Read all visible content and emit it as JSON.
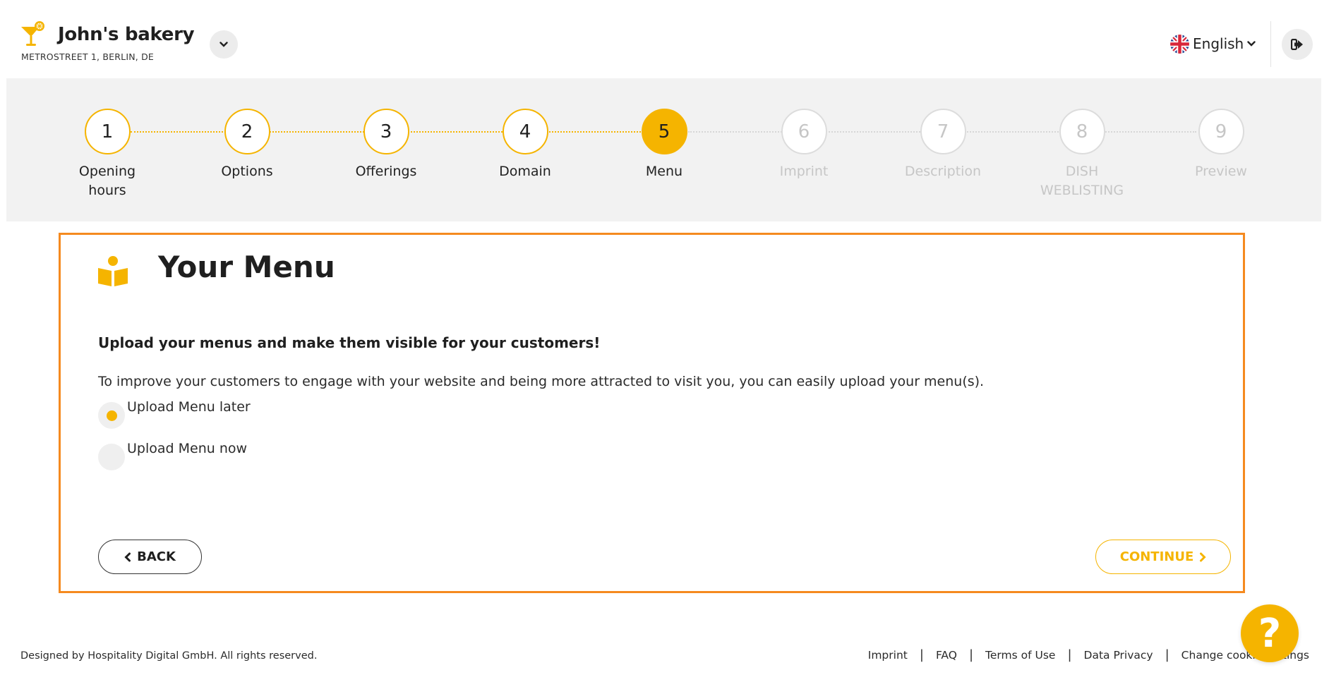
{
  "header": {
    "business_name": "John's bakery",
    "business_address": "METROSTREET 1, BERLIN, DE",
    "logo_icon": "cocktail-logo-icon",
    "dropdown_icon": "chevron-down-icon",
    "language": "English",
    "language_flag": "uk-flag-icon",
    "logout_icon": "logout-icon"
  },
  "stepper": {
    "steps": [
      {
        "number": "1",
        "label": "Opening hours",
        "state": "done"
      },
      {
        "number": "2",
        "label": "Options",
        "state": "done"
      },
      {
        "number": "3",
        "label": "Offerings",
        "state": "done"
      },
      {
        "number": "4",
        "label": "Domain",
        "state": "done"
      },
      {
        "number": "5",
        "label": "Menu",
        "state": "active"
      },
      {
        "number": "6",
        "label": "Imprint",
        "state": "future"
      },
      {
        "number": "7",
        "label": "Description",
        "state": "future"
      },
      {
        "number": "8",
        "label": "DISH WEBLISTING",
        "state": "future"
      },
      {
        "number": "9",
        "label": "Preview",
        "state": "future"
      }
    ]
  },
  "main": {
    "icon": "open-book-reader-icon",
    "title": "Your Menu",
    "subtitle": "Upload your menus and make them visible for your customers!",
    "description": "To improve your customers to engage with your website and being more attracted to visit you, you can easily upload your menu(s).",
    "options": [
      {
        "label": "Upload Menu later",
        "selected": true
      },
      {
        "label": "Upload Menu now",
        "selected": false
      }
    ],
    "back_label": "BACK",
    "continue_label": "CONTINUE"
  },
  "footer": {
    "copyright": "Designed by Hospitality Digital GmbH. All rights reserved.",
    "links": [
      "Imprint",
      "FAQ",
      "Terms of Use",
      "Data Privacy",
      "Change cookie settings"
    ]
  },
  "help": {
    "label": "?"
  },
  "colors": {
    "accent": "#f5b400",
    "highlight_border": "#f58a1f",
    "band": "#f2f2f2",
    "future": "#c6c6c6"
  }
}
